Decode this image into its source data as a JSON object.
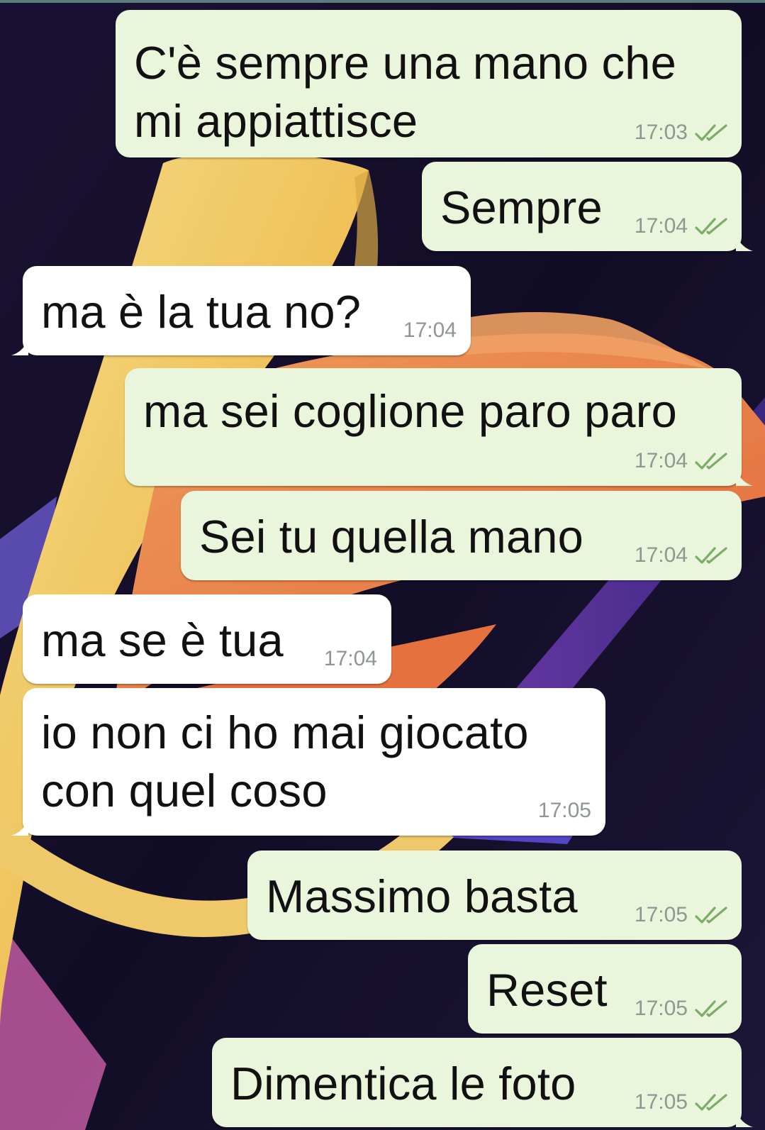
{
  "chat": {
    "messages": [
      {
        "dir": "out",
        "text": "C'è sempre una mano che\nmi appiattisce",
        "time": "17:03",
        "status": "read-double-check-icon"
      },
      {
        "dir": "out",
        "text": "Sempre",
        "time": "17:04",
        "status": "read-double-check-icon"
      },
      {
        "dir": "in",
        "text": "ma è la tua no?",
        "time": "17:04"
      },
      {
        "dir": "out",
        "text": "ma sei coglione paro paro",
        "time": "17:04",
        "status": "read-double-check-icon"
      },
      {
        "dir": "out",
        "text": "Sei tu quella mano",
        "time": "17:04",
        "status": "read-double-check-icon"
      },
      {
        "dir": "in",
        "text": "ma se è tua",
        "time": "17:04"
      },
      {
        "dir": "in",
        "text": "io non ci ho mai giocato\ncon quel coso",
        "time": "17:05"
      },
      {
        "dir": "out",
        "text": "Massimo basta",
        "time": "17:05",
        "status": "read-double-check-icon"
      },
      {
        "dir": "out",
        "text": "Reset",
        "time": "17:05",
        "status": "read-double-check-icon"
      },
      {
        "dir": "out",
        "text": "Dimentica le foto",
        "time": "17:05",
        "status": "read-double-check-icon"
      }
    ]
  },
  "colors": {
    "outgoing_bubble": "#eaf6dc",
    "incoming_bubble": "#ffffff",
    "tick": "#7cab6a",
    "timestamp": "#8e9791",
    "wallpaper_bg": "#140f2a"
  }
}
